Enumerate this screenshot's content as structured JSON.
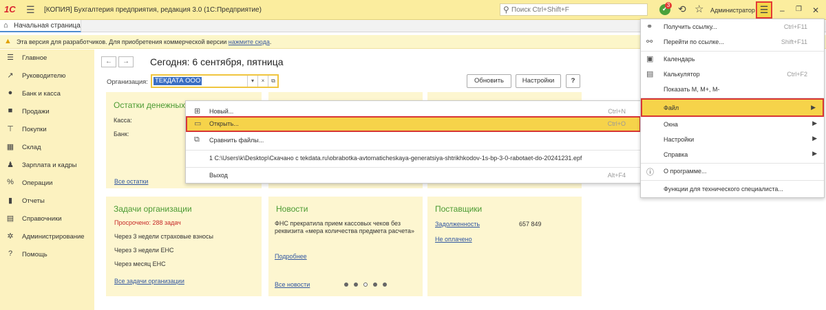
{
  "window": {
    "logo": "1С",
    "title": "[КОПИЯ] Бухгалтерия предприятия, редакция 3.0  (1С:Предприятие)",
    "search_placeholder": "Поиск Ctrl+Shift+F",
    "notification_count": "3",
    "user": "Администратор"
  },
  "tabs": {
    "home": "Начальная страница"
  },
  "infobar": {
    "message": "Эта версия для разработчиков. Для приобретения коммерческой версии ",
    "link": "нажмите сюда",
    "end": "."
  },
  "sidebar": {
    "items": [
      {
        "label": "Главное",
        "icon": "menu-icon"
      },
      {
        "label": "Руководителю",
        "icon": "chart-line-icon"
      },
      {
        "label": "Банк и касса",
        "icon": "bank-icon"
      },
      {
        "label": "Продажи",
        "icon": "bag-icon"
      },
      {
        "label": "Покупки",
        "icon": "cart-icon"
      },
      {
        "label": "Склад",
        "icon": "warehouse-icon"
      },
      {
        "label": "Зарплата и кадры",
        "icon": "person-icon"
      },
      {
        "label": "Операции",
        "icon": "operations-icon"
      },
      {
        "label": "Отчеты",
        "icon": "reports-icon"
      },
      {
        "label": "Справочники",
        "icon": "book-icon"
      },
      {
        "label": "Администрирование",
        "icon": "gear-icon"
      },
      {
        "label": "Помощь",
        "icon": "question-icon"
      }
    ]
  },
  "main": {
    "today": "Сегодня: 6 сентября, пятница",
    "org_label": "Организация:",
    "org_value": "ТЕКДАТА ООО",
    "refresh_button": "Обновить",
    "settings_button": "Настройки",
    "help_button": "?"
  },
  "cards": {
    "balances": {
      "title": "Остатки денежных",
      "cash_label": "Касса:",
      "bank_label": "Банк:",
      "link": "Все остатки"
    },
    "tasks": {
      "title": "Задачи организации",
      "overdue": "Просрочено: 288 задач",
      "items": [
        "Через 3 недели страховые взносы",
        "Через 3 недели ЕНС",
        "Через месяц ЕНС"
      ],
      "link": "Все задачи организации"
    },
    "news": {
      "title": "Новости",
      "text": "ФНС прекратила прием кассовых чеков без реквизита «мера количества предмета расчета»",
      "more": "Подробнее",
      "link": "Все новости"
    },
    "suppliers": {
      "title": "Поставщики",
      "debt_label": "Задолженность",
      "debt_value": "657 849",
      "unpaid": "Не оплачено"
    }
  },
  "file_menu": {
    "new": {
      "label": "Новый...",
      "key": "Ctrl+N"
    },
    "open": {
      "label": "Открыть...",
      "key": "Ctrl+O"
    },
    "compare": {
      "label": "Сравнить файлы..."
    },
    "recent": {
      "label": "1 C:\\Users\\k\\Desktop\\Скачано с tekdata.ru\\obrabotka-avtomaticheskaya-generatsiya-shtrikhkodov-1s-bp-3-0-rabotaet-do-20241231.epf"
    },
    "exit": {
      "label": "Выход",
      "key": "Alt+F4"
    }
  },
  "main_menu": {
    "get_link": {
      "label": "Получить ссылку...",
      "key": "Ctrl+F11"
    },
    "go_link": {
      "label": "Перейти по ссылке...",
      "key": "Shift+F11"
    },
    "calendar": {
      "label": "Календарь"
    },
    "calculator": {
      "label": "Калькулятор",
      "key": "Ctrl+F2"
    },
    "show_m": {
      "label": "Показать M, M+, M-"
    },
    "file": {
      "label": "Файл"
    },
    "windows": {
      "label": "Окна"
    },
    "settings": {
      "label": "Настройки"
    },
    "help": {
      "label": "Справка"
    },
    "about": {
      "label": "О программе..."
    },
    "tech": {
      "label": "Функции для технического специалиста..."
    }
  },
  "colors": {
    "accent_yellow": "#f6d34a",
    "highlight_border": "#d73535",
    "card_title": "#4a9a32",
    "link": "#2f55a0"
  }
}
